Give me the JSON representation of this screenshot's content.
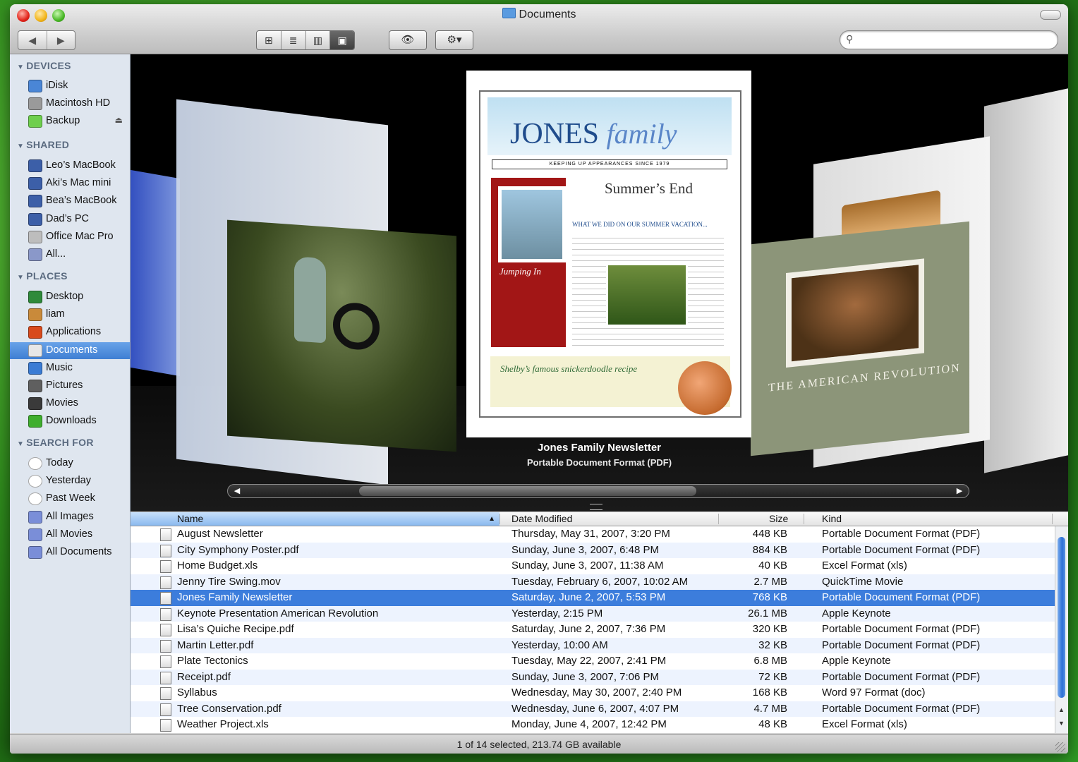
{
  "window": {
    "title": "Documents"
  },
  "toolbar": {
    "back": "◀",
    "forward": "▶",
    "view_icons": "⊞",
    "view_list": "≣",
    "view_columns": "▥",
    "view_coverflow": "▣",
    "quicklook": "👁",
    "action": "⚙▾"
  },
  "search": {
    "value": "",
    "placeholder": ""
  },
  "sidebar": {
    "sections": [
      {
        "label": "DEVICES",
        "items": [
          {
            "label": "iDisk",
            "icon": "idisk-icon",
            "color": "#4a86d6"
          },
          {
            "label": "Macintosh HD",
            "icon": "hard-drive-icon",
            "color": "#9a9a9a"
          },
          {
            "label": "Backup",
            "icon": "drive-icon",
            "color": "#6ecf4d",
            "eject": "⏏"
          }
        ]
      },
      {
        "label": "SHARED",
        "items": [
          {
            "label": "Leo’s MacBook",
            "icon": "laptop-icon",
            "color": "#3c5fa8"
          },
          {
            "label": "Aki’s Mac mini",
            "icon": "monitor-icon",
            "color": "#3c5fa8"
          },
          {
            "label": "Bea’s MacBook",
            "icon": "laptop-icon",
            "color": "#3c5fa8"
          },
          {
            "label": "Dad’s PC",
            "icon": "pc-monitor-icon",
            "color": "#3c5fa8"
          },
          {
            "label": "Office Mac Pro",
            "icon": "mac-pro-icon",
            "color": "#bdbdbd"
          },
          {
            "label": "All...",
            "icon": "network-globe-icon",
            "color": "#8a98c9"
          }
        ]
      },
      {
        "label": "PLACES",
        "items": [
          {
            "label": "Desktop",
            "icon": "desktop-icon",
            "color": "#2f8a3a"
          },
          {
            "label": "liam",
            "icon": "home-icon",
            "color": "#c98a3a"
          },
          {
            "label": "Applications",
            "icon": "applications-icon",
            "color": "#d84a1c"
          },
          {
            "label": "Documents",
            "icon": "documents-folder-icon",
            "color": "#e7e7e7",
            "selected": true
          },
          {
            "label": "Music",
            "icon": "music-icon",
            "color": "#3a7bd4"
          },
          {
            "label": "Pictures",
            "icon": "pictures-icon",
            "color": "#5f5f5f"
          },
          {
            "label": "Movies",
            "icon": "movies-icon",
            "color": "#3a3a3a"
          },
          {
            "label": "Downloads",
            "icon": "downloads-icon",
            "color": "#3fae2e"
          }
        ]
      },
      {
        "label": "SEARCH FOR",
        "items": [
          {
            "label": "Today",
            "icon": "clock-icon",
            "color": "#ffffff"
          },
          {
            "label": "Yesterday",
            "icon": "clock-icon",
            "color": "#ffffff"
          },
          {
            "label": "Past Week",
            "icon": "clock-icon",
            "color": "#ffffff"
          },
          {
            "label": "All Images",
            "icon": "smart-folder-icon",
            "color": "#7a8ed8"
          },
          {
            "label": "All Movies",
            "icon": "smart-folder-icon",
            "color": "#7a8ed8"
          },
          {
            "label": "All Documents",
            "icon": "smart-folder-icon",
            "color": "#7a8ed8"
          }
        ]
      }
    ]
  },
  "coverflow": {
    "selected_title": "Jones Family Newsletter",
    "selected_kind": "Portable Document Format (PDF)",
    "newsletter": {
      "title_a": "JONES",
      "title_b": "family",
      "subtitle": "KEEPING UP APPEARANCES SINCE 1979",
      "heading": "Summer’s End",
      "what": "WHAT WE DID ON OUR SUMMER VACATION...",
      "jumping": "Jumping In",
      "recipe": "Shelby’s famous snickerdoodle recipe"
    },
    "keynote_title": "THE AMERICAN REVOLUTION",
    "scroll_left": "◀",
    "scroll_right": "▶"
  },
  "list": {
    "columns": {
      "name": "Name",
      "date": "Date Modified",
      "size": "Size",
      "kind": "Kind",
      "sort_arrow": "▲"
    },
    "rows": [
      {
        "name": "August Newsletter",
        "date": "Thursday, May 31, 2007, 3:20 PM",
        "size": "448 KB",
        "kind": "Portable Document Format (PDF)"
      },
      {
        "name": "City Symphony Poster.pdf",
        "date": "Sunday, June 3, 2007, 6:48 PM",
        "size": "884 KB",
        "kind": "Portable Document Format (PDF)"
      },
      {
        "name": "Home Budget.xls",
        "date": "Sunday, June 3, 2007, 11:38 AM",
        "size": "40 KB",
        "kind": "Excel Format (xls)"
      },
      {
        "name": "Jenny Tire Swing.mov",
        "date": "Tuesday, February 6, 2007, 10:02 AM",
        "size": "2.7 MB",
        "kind": "QuickTime Movie"
      },
      {
        "name": "Jones Family Newsletter",
        "date": "Saturday, June 2, 2007, 5:53 PM",
        "size": "768 KB",
        "kind": "Portable Document Format (PDF)",
        "selected": true
      },
      {
        "name": "Keynote Presentation American Revolution",
        "date": "Yesterday, 2:15 PM",
        "size": "26.1 MB",
        "kind": "Apple Keynote"
      },
      {
        "name": "Lisa’s Quiche Recipe.pdf",
        "date": "Saturday, June 2, 2007, 7:36 PM",
        "size": "320 KB",
        "kind": "Portable Document Format (PDF)"
      },
      {
        "name": "Martin Letter.pdf",
        "date": "Yesterday, 10:00 AM",
        "size": "32 KB",
        "kind": "Portable Document Format (PDF)"
      },
      {
        "name": "Plate Tectonics",
        "date": "Tuesday, May 22, 2007, 2:41 PM",
        "size": "6.8 MB",
        "kind": "Apple Keynote"
      },
      {
        "name": "Receipt.pdf",
        "date": "Sunday, June 3, 2007, 7:06 PM",
        "size": "72 KB",
        "kind": "Portable Document Format (PDF)"
      },
      {
        "name": "Syllabus",
        "date": "Wednesday, May 30, 2007, 2:40 PM",
        "size": "168 KB",
        "kind": "Word 97 Format (doc)"
      },
      {
        "name": "Tree Conservation.pdf",
        "date": "Wednesday, June 6, 2007, 4:07 PM",
        "size": "4.7 MB",
        "kind": "Portable Document Format (PDF)"
      },
      {
        "name": "Weather Project.xls",
        "date": "Monday, June 4, 2007, 12:42 PM",
        "size": "48 KB",
        "kind": "Excel Format (xls)"
      }
    ]
  },
  "status": {
    "text": "1 of 14 selected, 213.74 GB available"
  },
  "colors": {
    "selection": "#3c7ddc",
    "sidebar_bg": "#dfe6ef",
    "alt_row": "#edf3fe"
  }
}
